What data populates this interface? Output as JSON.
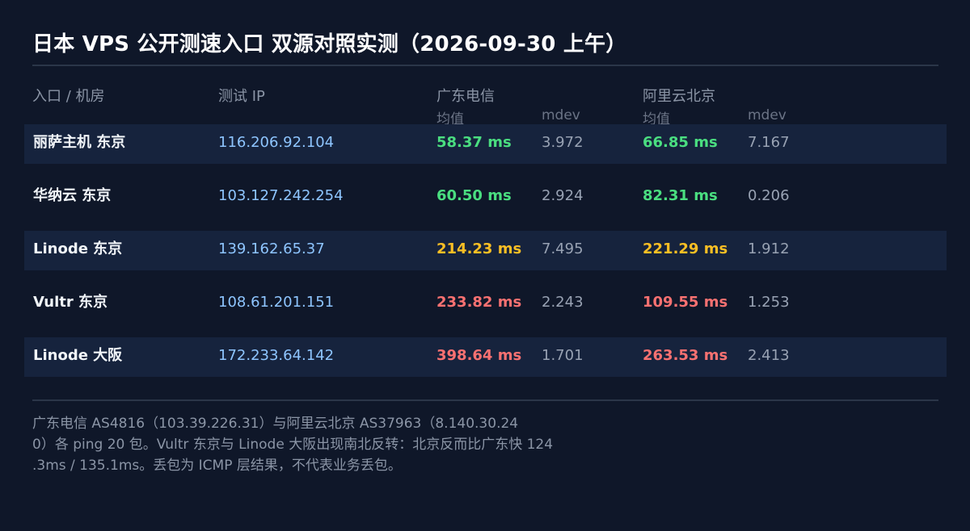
{
  "title": "日本 VPS 公开测速入口 双源对照实测（2026-09-30 上午）",
  "columns": {
    "entry": "入口 / 机房",
    "ip": "测试 IP",
    "gd_label": "广东电信",
    "ali_label": "阿里云北京",
    "avg": "均值",
    "mdev": "mdev"
  },
  "colors": {
    "good": "#4ade80",
    "warn": "#fbbf24",
    "bad": "#f87171"
  },
  "rows": [
    {
      "name": "丽萨主机 东京",
      "ip": "116.206.92.104",
      "gd_avg": "58.37 ms",
      "gd_mdev": "3.972",
      "ali_avg": "66.85 ms",
      "ali_mdev": "7.167",
      "gd_level": "good",
      "ali_level": "good"
    },
    {
      "name": "华纳云 东京",
      "ip": "103.127.242.254",
      "gd_avg": "60.50 ms",
      "gd_mdev": "2.924",
      "ali_avg": "82.31 ms",
      "ali_mdev": "0.206",
      "gd_level": "good",
      "ali_level": "good"
    },
    {
      "name": "Linode 东京",
      "ip": "139.162.65.37",
      "gd_avg": "214.23 ms",
      "gd_mdev": "7.495",
      "ali_avg": "221.29 ms",
      "ali_mdev": "1.912",
      "gd_level": "warn",
      "ali_level": "warn"
    },
    {
      "name": "Vultr 东京",
      "ip": "108.61.201.151",
      "gd_avg": "233.82 ms",
      "gd_mdev": "2.243",
      "ali_avg": "109.55 ms",
      "ali_mdev": "1.253",
      "gd_level": "bad",
      "ali_level": "bad"
    },
    {
      "name": "Linode 大阪",
      "ip": "172.233.64.142",
      "gd_avg": "398.64 ms",
      "gd_mdev": "1.701",
      "ali_avg": "263.53 ms",
      "ali_mdev": "2.413",
      "gd_level": "bad",
      "ali_level": "bad"
    }
  ],
  "footnote": "广东电信 AS4816（103.39.226.31）与阿里云北京 AS37963（8.140.30.24\n0）各 ping 20 包。Vultr 东京与 Linode 大阪出现南北反转：北京反而比广东快 124\n.3ms / 135.1ms。丢包为 ICMP 层结果，不代表业务丢包。"
}
